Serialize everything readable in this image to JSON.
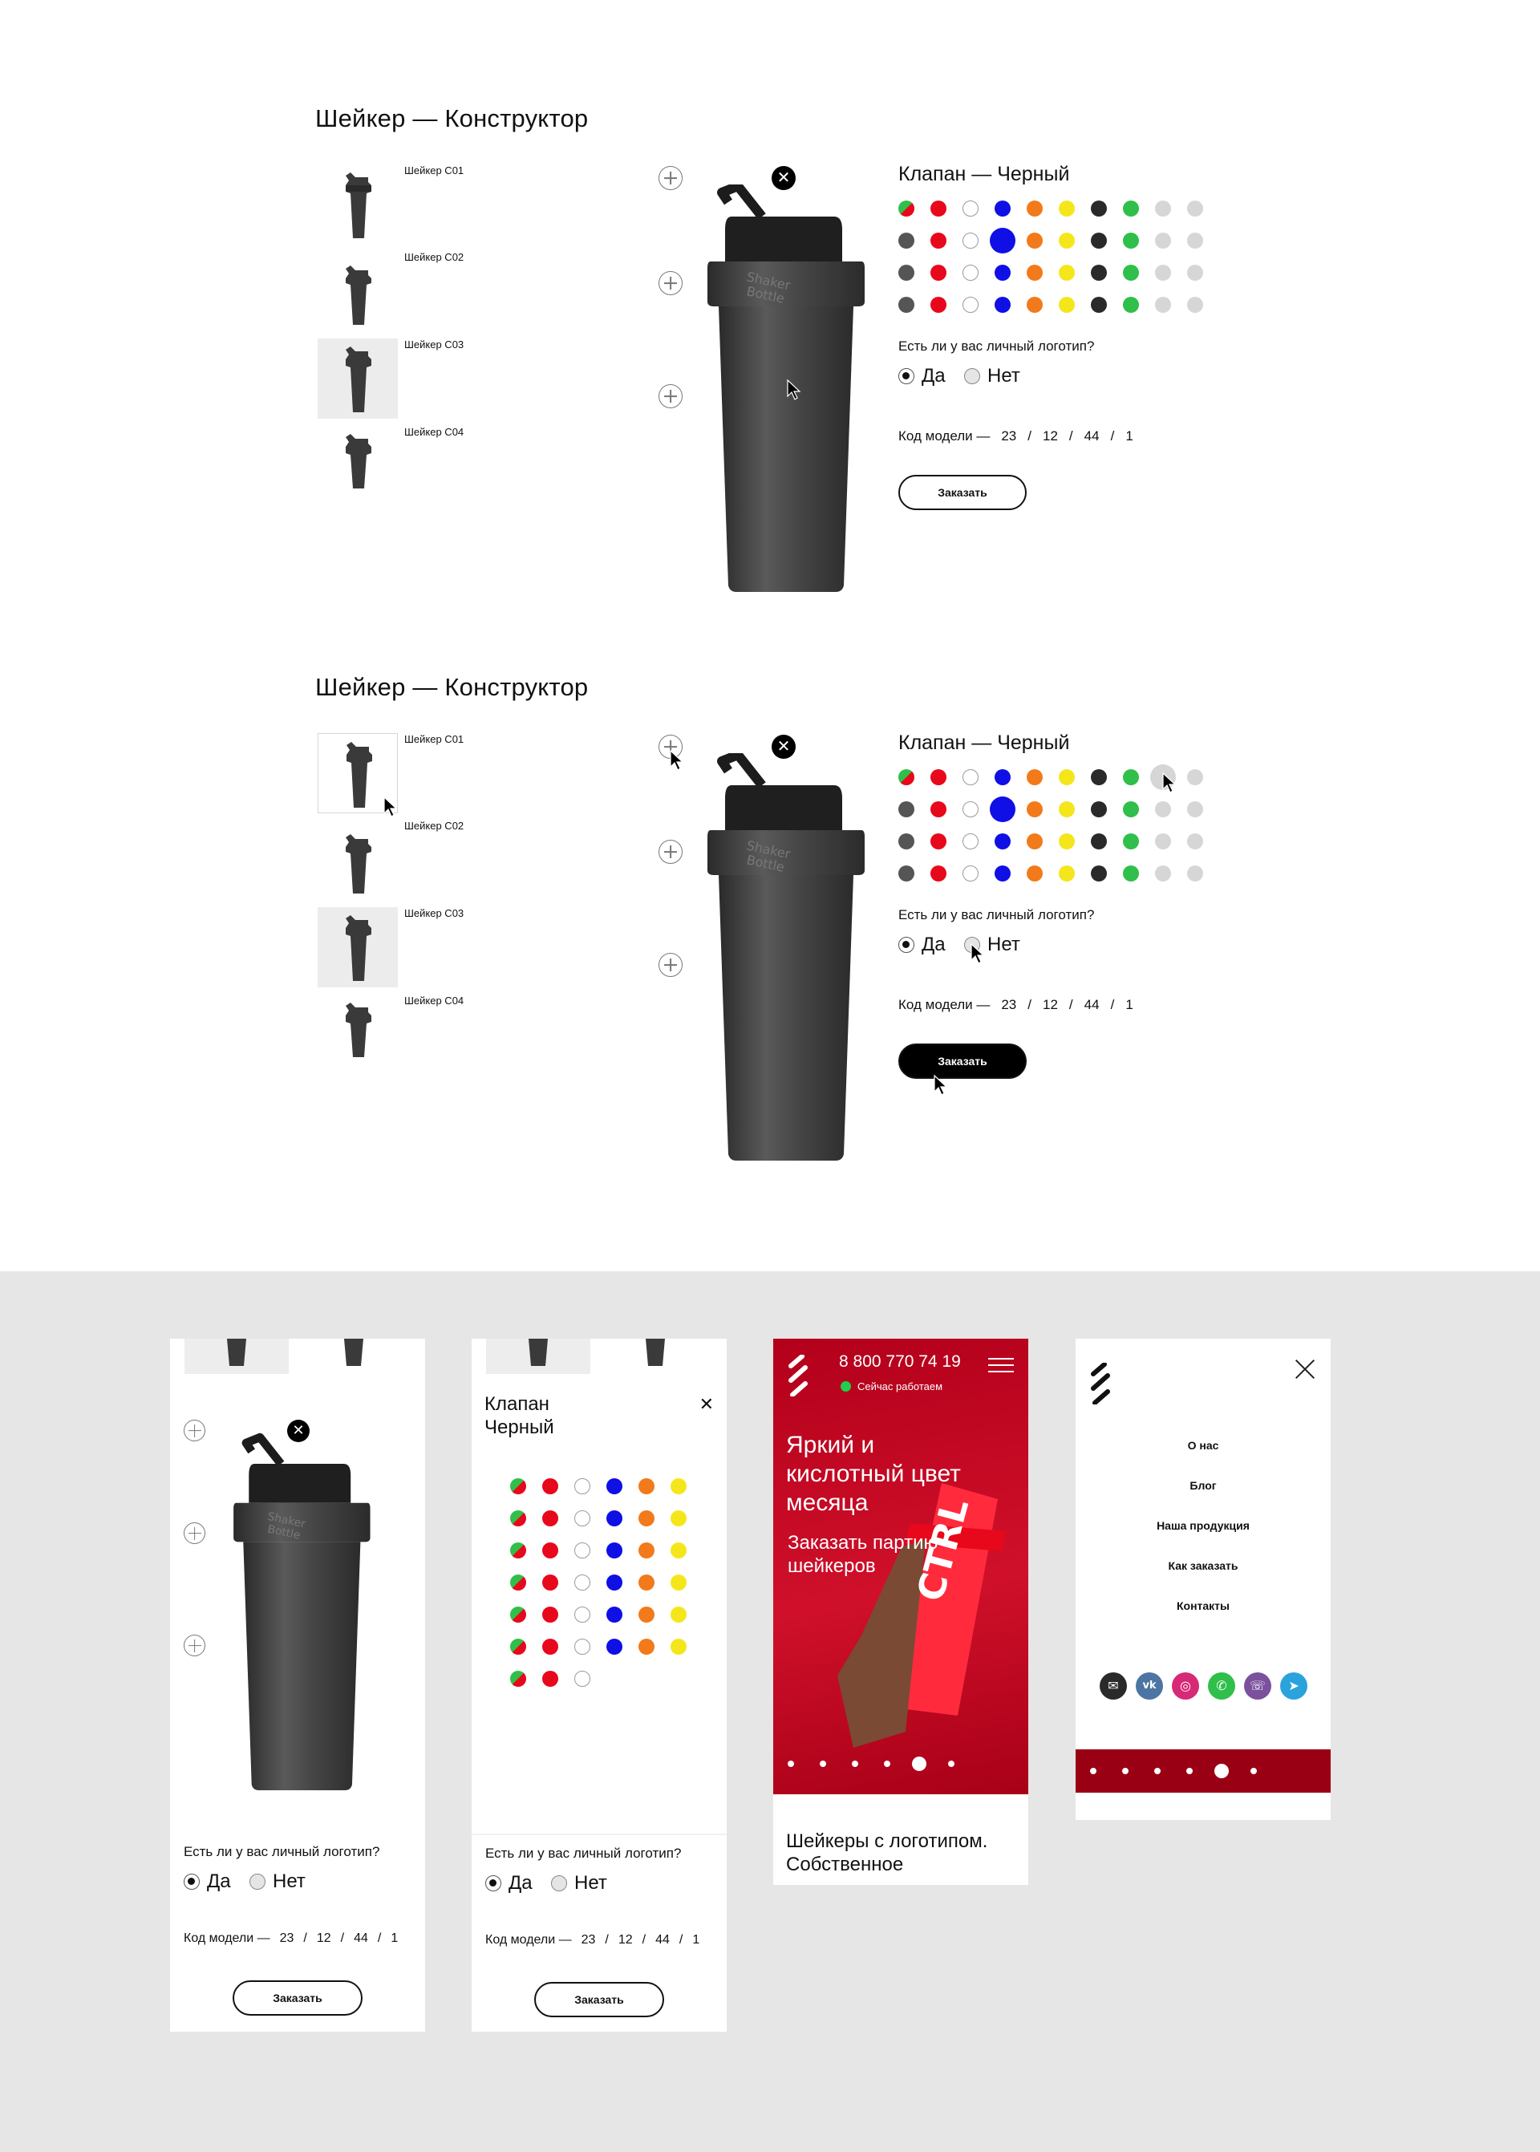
{
  "constructor": {
    "title": "Шейкер — Конструктор",
    "models": [
      {
        "label": "Шейкер C01"
      },
      {
        "label": "Шейкер C02"
      },
      {
        "label": "Шейкер C03"
      },
      {
        "label": "Шейкер C04"
      }
    ],
    "active_model_index": 2,
    "valve_title": "Клапан — Черный",
    "logo_question": "Есть ли у вас личный логотип?",
    "options": {
      "yes": "Да",
      "no": "Нет"
    },
    "selected_option": "Да",
    "code_label": "Код модели —",
    "code_parts": [
      "23",
      "12",
      "44",
      "1"
    ],
    "code_separator": "/",
    "order_label": "Заказать"
  },
  "colors": {
    "palette": [
      "#c8c8c8",
      "#e8081b",
      "#ffffff",
      "#0f0fe6",
      "#f27a1a",
      "#f5e61c",
      "#2a2a2a",
      "#2fbf4a",
      "#d6d6d6",
      "#d6d6d6"
    ],
    "mixed_first": [
      "#2fbf4a",
      "#e8081b"
    ],
    "dark_gray": "#555555",
    "brand_red": "#c8102e",
    "live_green": "#1fd04b"
  },
  "mobile_popup": {
    "title_line1": "Клапан",
    "title_line2": "Черный",
    "close_icon": "close-icon"
  },
  "hero": {
    "phone": "8 800 770 74 19",
    "status": "Сейчас работаем",
    "headline": "Яркий и кислотный цвет месяца",
    "cta": "Заказать партию шейкеров",
    "bottle_brand": "CTRL",
    "slides": 6,
    "active_slide": 4,
    "bottom_text": "Шейкеры с логотипом. Собственное"
  },
  "menu": {
    "items": [
      "О нас",
      "Блог",
      "Наша продукция",
      "Как заказать",
      "Контакты"
    ],
    "social": [
      {
        "icon": "mail-icon",
        "color": "#2a2a2a"
      },
      {
        "icon": "vk-icon",
        "color": "#4c75a3"
      },
      {
        "icon": "instagram-icon",
        "color": "#d62976"
      },
      {
        "icon": "phone-icon",
        "color": "#2fbf4a"
      },
      {
        "icon": "viber-icon",
        "color": "#7b519d"
      },
      {
        "icon": "telegram-icon",
        "color": "#2aa3dd"
      }
    ]
  }
}
